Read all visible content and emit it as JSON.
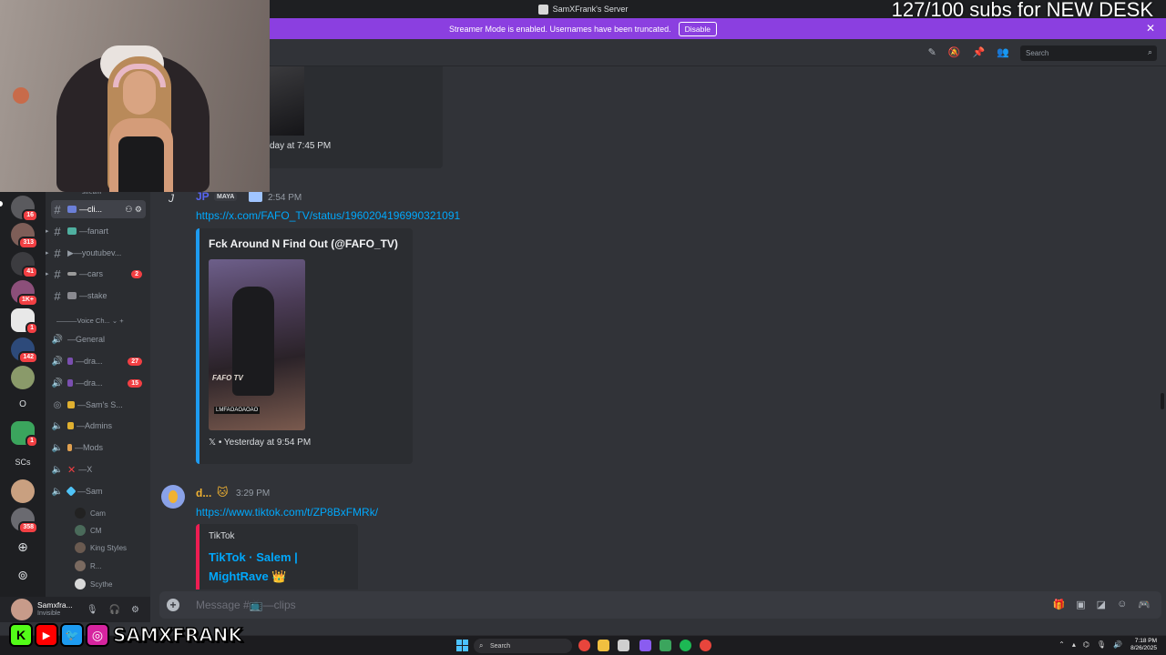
{
  "window": {
    "title": "SamXFrank's Server"
  },
  "overlay": {
    "subs_goal": "127/100 subs for NEW DESK",
    "social_letters": [
      "K",
      "▶",
      "🐦",
      "◎"
    ],
    "handle": "SAMXFRANK"
  },
  "streamer_bar": {
    "text": "Streamer Mode is enabled. Usernames have been truncated.",
    "button": "Disable",
    "close": "✕"
  },
  "header": {
    "search_placeholder": "Search"
  },
  "servers": [
    {
      "badge": "16"
    },
    {
      "badge": "313"
    },
    {
      "badge": "41"
    },
    {
      "badge": "1K+"
    },
    {
      "badge": "1"
    },
    {
      "badge": "142"
    },
    {
      "badge": ""
    },
    {
      "text": "O"
    },
    {
      "badge": "1"
    },
    {
      "text": "SCs"
    },
    {
      "badge": ""
    },
    {
      "badge": "358"
    }
  ],
  "channels": {
    "stream_cut": "stream",
    "text": [
      {
        "name": "—cli...",
        "active": true
      },
      {
        "name": "—fanart"
      },
      {
        "name": "▶—youtubev..."
      },
      {
        "name": "—cars",
        "count": "2"
      },
      {
        "name": "—stake"
      }
    ],
    "voice_category": "———Voice Ch...",
    "voice": [
      {
        "name": "—General"
      },
      {
        "name": "—dra...",
        "count": "27"
      },
      {
        "name": "—dra...",
        "count": "15"
      },
      {
        "name": "—Sam's S..."
      },
      {
        "name": "—Admins"
      },
      {
        "name": "—Mods"
      },
      {
        "name": "—X"
      },
      {
        "name": "—Sam"
      }
    ],
    "voice_users": [
      "Cam",
      "CM",
      "King Styles",
      "R...",
      "Scythe"
    ]
  },
  "user_panel": {
    "name": "Samxfra...",
    "status": "Invisible"
  },
  "messages": {
    "prev_timestamp": "day at 7:45 PM",
    "m1": {
      "author": "JP",
      "tag": "MAYA",
      "time": "2:54 PM",
      "link": "https://x.com/FAFO_TV/status/1960204196990321091",
      "embed_title": "Fck Around N Find Out (@FAFO_TV)",
      "video_watermark": "FAFO TV",
      "video_tag": "LMFAOAOAOAO",
      "embed_footer": "𝕏 • Yesterday at 9:54 PM"
    },
    "m2": {
      "author": "d...",
      "time": "3:29 PM",
      "link": "https://www.tiktok.com/t/ZP8BxFMRk/",
      "provider": "TikTok",
      "title": "TikTok · Salem | MightRave 👑"
    }
  },
  "composer": {
    "placeholder": "Message #📺—clips"
  },
  "taskbar": {
    "search": "Search",
    "time": "7:18 PM",
    "date": "8/26/2025"
  },
  "colors": {
    "blurple": "#5865f2",
    "streamer_purple": "#8b3fe0",
    "link": "#00a8fc",
    "mention_red": "#f23f43"
  }
}
